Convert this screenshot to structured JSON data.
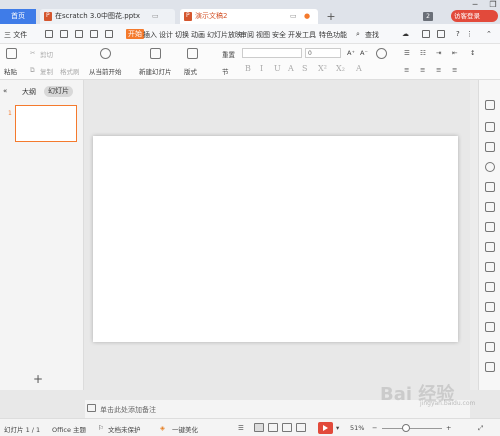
{
  "tabbar": {
    "home": "首页",
    "tabs": [
      {
        "label": "在scratch 3.0中图花.pptx",
        "active": false
      },
      {
        "label": "演示文稿2",
        "active": true
      }
    ],
    "new_tab": "+",
    "badge": "2",
    "login": "访客登录"
  },
  "menu": {
    "file": "三 文件",
    "items": [
      "开始",
      "插入",
      "设计",
      "切换",
      "动画",
      "幻灯片放映",
      "审阅",
      "视图",
      "安全",
      "开发工具",
      "特色功能"
    ],
    "active": "开始",
    "search": "查找"
  },
  "ribbon": {
    "paste": "粘贴",
    "cut": "剪切",
    "copy": "复制",
    "format_painter": "格式刷",
    "from_current": "从当前开始",
    "new_slide": "新建幻灯片",
    "layout": "版式",
    "section": "节",
    "reset": "重置",
    "font_size": "0"
  },
  "sidepanel": {
    "tab_outline": "大纲",
    "tab_slides": "幻灯片",
    "slide_number": "1",
    "add": "+"
  },
  "notes": {
    "placeholder": "单击此处添加备注"
  },
  "status": {
    "slide_count": "幻灯片 1 / 1",
    "theme": "Office 主题",
    "protect": "文档未保护",
    "beautify": "一键美化",
    "zoom": "51%",
    "zoom_level": 0.51
  },
  "watermark": {
    "text": "Bai 经验",
    "sub": "jingyan.baidu.com"
  },
  "colors": {
    "accent": "#f47a2d",
    "home_tab": "#3f7ce8",
    "login": "#e24a3b"
  }
}
